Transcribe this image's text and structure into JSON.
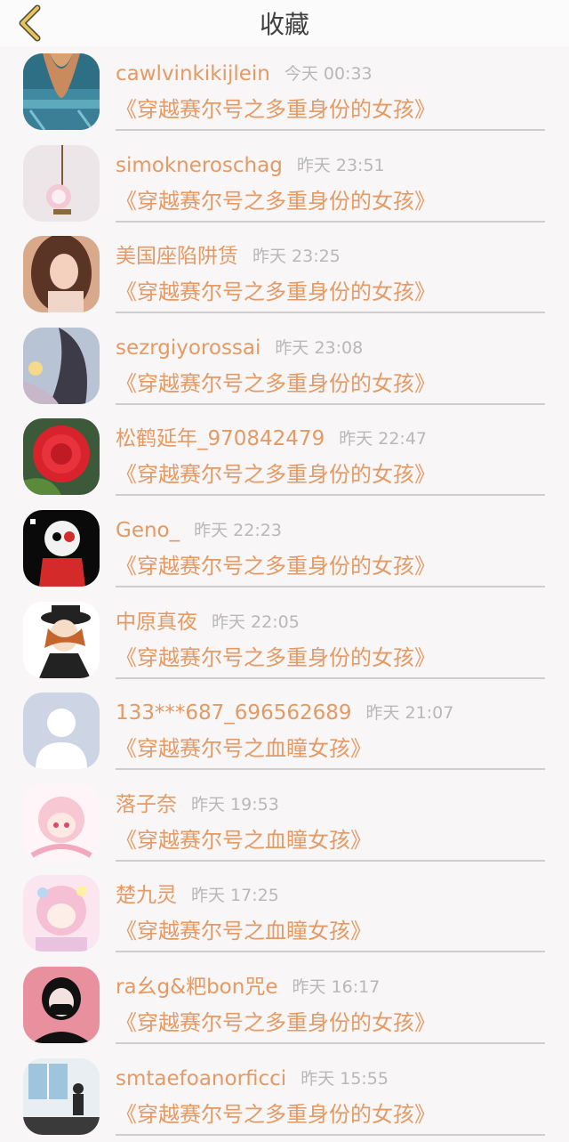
{
  "header": {
    "title": "收藏",
    "back_icon": "chevron-left-icon",
    "back_color": "#e8c35a"
  },
  "colors": {
    "accent": "#e49a64",
    "timestamp": "#b8b8b8",
    "divider": "#cfcdcd",
    "background": "#f8f6f7"
  },
  "favorites": [
    {
      "username": "cawlvinkikijlein",
      "time": "今天 00:33",
      "book": "《穿越赛尔号之多重身份的女孩》",
      "avatar": "avatar-denim"
    },
    {
      "username": "simokneroschag",
      "time": "昨天 23:51",
      "book": "《穿越赛尔号之多重身份的女孩》",
      "avatar": "avatar-pendant"
    },
    {
      "username": "美国座陷阱赁",
      "time": "昨天 23:25",
      "book": "《穿越赛尔号之多重身份的女孩》",
      "avatar": "avatar-girl-photo"
    },
    {
      "username": "sezrgiyorossai",
      "time": "昨天 23:08",
      "book": "《穿越赛尔号之多重身份的女孩》",
      "avatar": "avatar-girl-hair"
    },
    {
      "username": "松鹤延年_970842479",
      "time": "昨天 22:47",
      "book": "《穿越赛尔号之多重身份的女孩》",
      "avatar": "avatar-red-flower"
    },
    {
      "username": "Geno_",
      "time": "昨天 22:23",
      "book": "《穿越赛尔号之多重身份的女孩》",
      "avatar": "avatar-skeleton"
    },
    {
      "username": "中原真夜",
      "time": "昨天 22:05",
      "book": "《穿越赛尔号之多重身份的女孩》",
      "avatar": "avatar-anime-hat"
    },
    {
      "username": "133***687_696562689",
      "time": "昨天 21:07",
      "book": "《穿越赛尔号之血瞳女孩》",
      "avatar": "avatar-default-person"
    },
    {
      "username": "落子奈",
      "time": "昨天 19:53",
      "book": "《穿越赛尔号之血瞳女孩》",
      "avatar": "avatar-anime-pink"
    },
    {
      "username": "楚九灵",
      "time": "昨天 17:25",
      "book": "《穿越赛尔号之血瞳女孩》",
      "avatar": "avatar-anime-pastel"
    },
    {
      "username": "ra幺g&粑bon咒e",
      "time": "昨天 16:17",
      "book": "《穿越赛尔号之多重身份的女孩》",
      "avatar": "avatar-masked-girl"
    },
    {
      "username": "smtaefoanorficci",
      "time": "昨天 15:55",
      "book": "《穿越赛尔号之多重身份的女孩》",
      "avatar": "avatar-room-photo"
    }
  ]
}
